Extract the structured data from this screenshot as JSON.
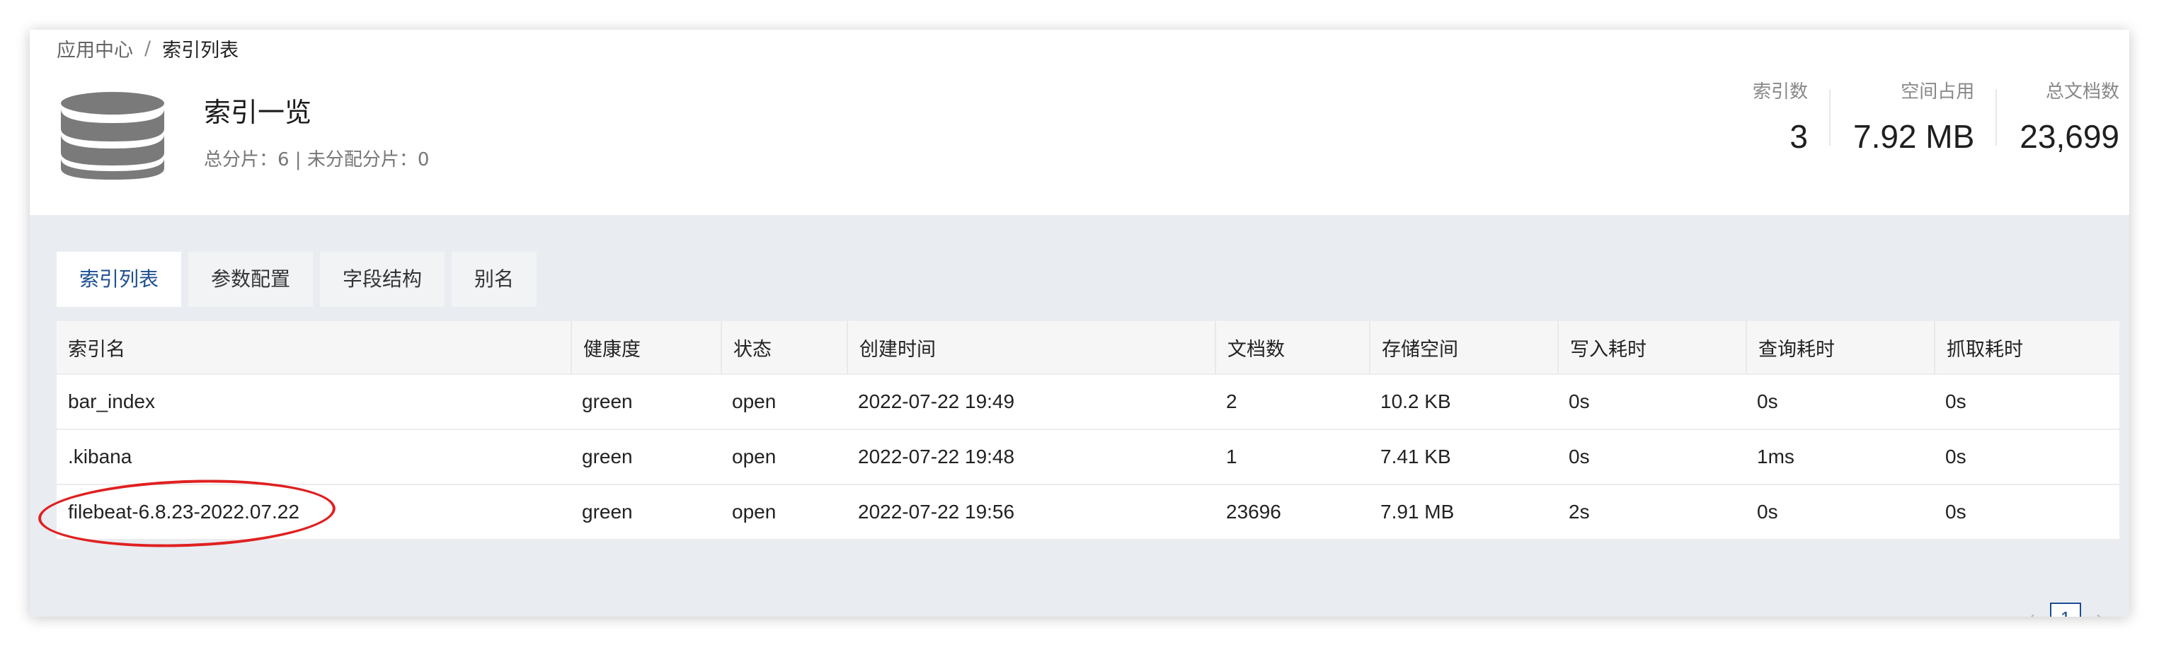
{
  "breadcrumb": {
    "parent": "应用中心",
    "separator": "/",
    "current": "索引列表"
  },
  "header": {
    "title": "索引一览",
    "shard_info": "总分片：6 | 未分配分片：0",
    "icon": "database-icon"
  },
  "stats": [
    {
      "label": "索引数",
      "value": "3"
    },
    {
      "label": "空间占用",
      "value": "7.92 MB"
    },
    {
      "label": "总文档数",
      "value": "23,699"
    }
  ],
  "tabs": [
    {
      "label": "索引列表",
      "active": true
    },
    {
      "label": "参数配置",
      "active": false
    },
    {
      "label": "字段结构",
      "active": false
    },
    {
      "label": "别名",
      "active": false
    }
  ],
  "table": {
    "columns": [
      "索引名",
      "健康度",
      "状态",
      "创建时间",
      "文档数",
      "存储空间",
      "写入耗时",
      "查询耗时",
      "抓取耗时"
    ],
    "rows": [
      [
        "bar_index",
        "green",
        "open",
        "2022-07-22 19:49",
        "2",
        "10.2 KB",
        "0s",
        "0s",
        "0s"
      ],
      [
        ".kibana",
        "green",
        "open",
        "2022-07-22 19:48",
        "1",
        "7.41 KB",
        "0s",
        "1ms",
        "0s"
      ],
      [
        "filebeat-6.8.23-2022.07.22",
        "green",
        "open",
        "2022-07-22 19:56",
        "23696",
        "7.91 MB",
        "2s",
        "0s",
        "0s"
      ]
    ]
  },
  "pagination": {
    "current_page": "1",
    "prev": "‹",
    "next": "›"
  },
  "colors": {
    "accent": "#1d4f91",
    "annotation": "#e02020",
    "content_bg": "#e9ecf1"
  }
}
